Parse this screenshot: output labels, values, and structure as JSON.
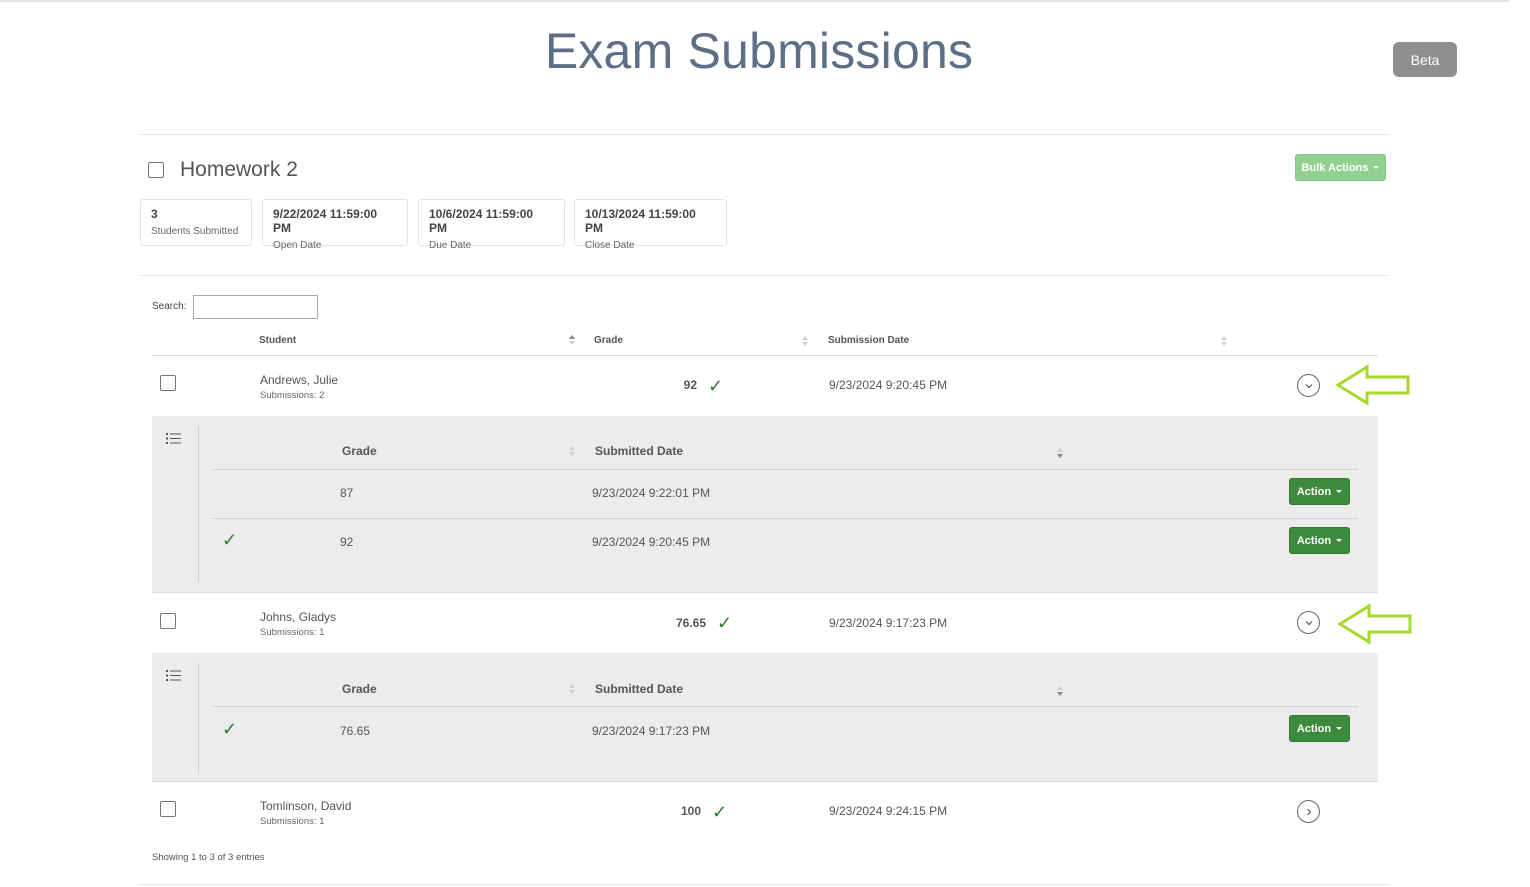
{
  "page": {
    "title": "Exam Submissions",
    "beta_label": "Beta"
  },
  "assignment": {
    "title": "Homework 2",
    "bulk_actions_label": "Bulk Actions",
    "stats": [
      {
        "value": "3",
        "label": "Students Submitted"
      },
      {
        "value": "9/22/2024 11:59:00 PM",
        "label": "Open Date"
      },
      {
        "value": "10/6/2024 11:59:00 PM",
        "label": "Due Date"
      },
      {
        "value": "10/13/2024 11:59:00 PM",
        "label": "Close Date"
      }
    ]
  },
  "search": {
    "label": "Search:",
    "value": ""
  },
  "table": {
    "columns": {
      "student": "Student",
      "grade": "Grade",
      "submission_date": "Submission Date"
    },
    "rows": [
      {
        "name": "Andrews, Julie",
        "submissions": "Submissions: 2",
        "grade": "92",
        "date": "9/23/2024 9:20:45 PM",
        "expanded": true,
        "detail": {
          "columns": {
            "grade": "Grade",
            "submitted": "Submitted Date"
          },
          "rows": [
            {
              "grade": "87",
              "date": "9/23/2024 9:22:01 PM",
              "selected": false,
              "action": "Action"
            },
            {
              "grade": "92",
              "date": "9/23/2024 9:20:45 PM",
              "selected": true,
              "action": "Action"
            }
          ]
        }
      },
      {
        "name": "Johns, Gladys",
        "submissions": "Submissions: 1",
        "grade": "76.65",
        "date": "9/23/2024 9:17:23 PM",
        "expanded": true,
        "detail": {
          "columns": {
            "grade": "Grade",
            "submitted": "Submitted Date"
          },
          "rows": [
            {
              "grade": "76.65",
              "date": "9/23/2024 9:17:23 PM",
              "selected": true,
              "action": "Action"
            }
          ]
        }
      },
      {
        "name": "Tomlinson, David",
        "submissions": "Submissions: 1",
        "grade": "100",
        "date": "9/23/2024 9:24:15 PM",
        "expanded": false
      }
    ]
  },
  "footer": {
    "info": "Showing 1 to 3 of 3 entries"
  },
  "colors": {
    "title": "#5d6f86",
    "action_green": "#3c8a3c",
    "bulk_green": "#92d092",
    "check_green": "#2e7d32",
    "annotation_arrow": "#a6d92b",
    "detail_bg": "#ececec"
  },
  "icons": [
    "checkmark-icon",
    "chevron-down-icon",
    "chevron-right-icon",
    "list-icon",
    "annotation-arrow-icon"
  ]
}
